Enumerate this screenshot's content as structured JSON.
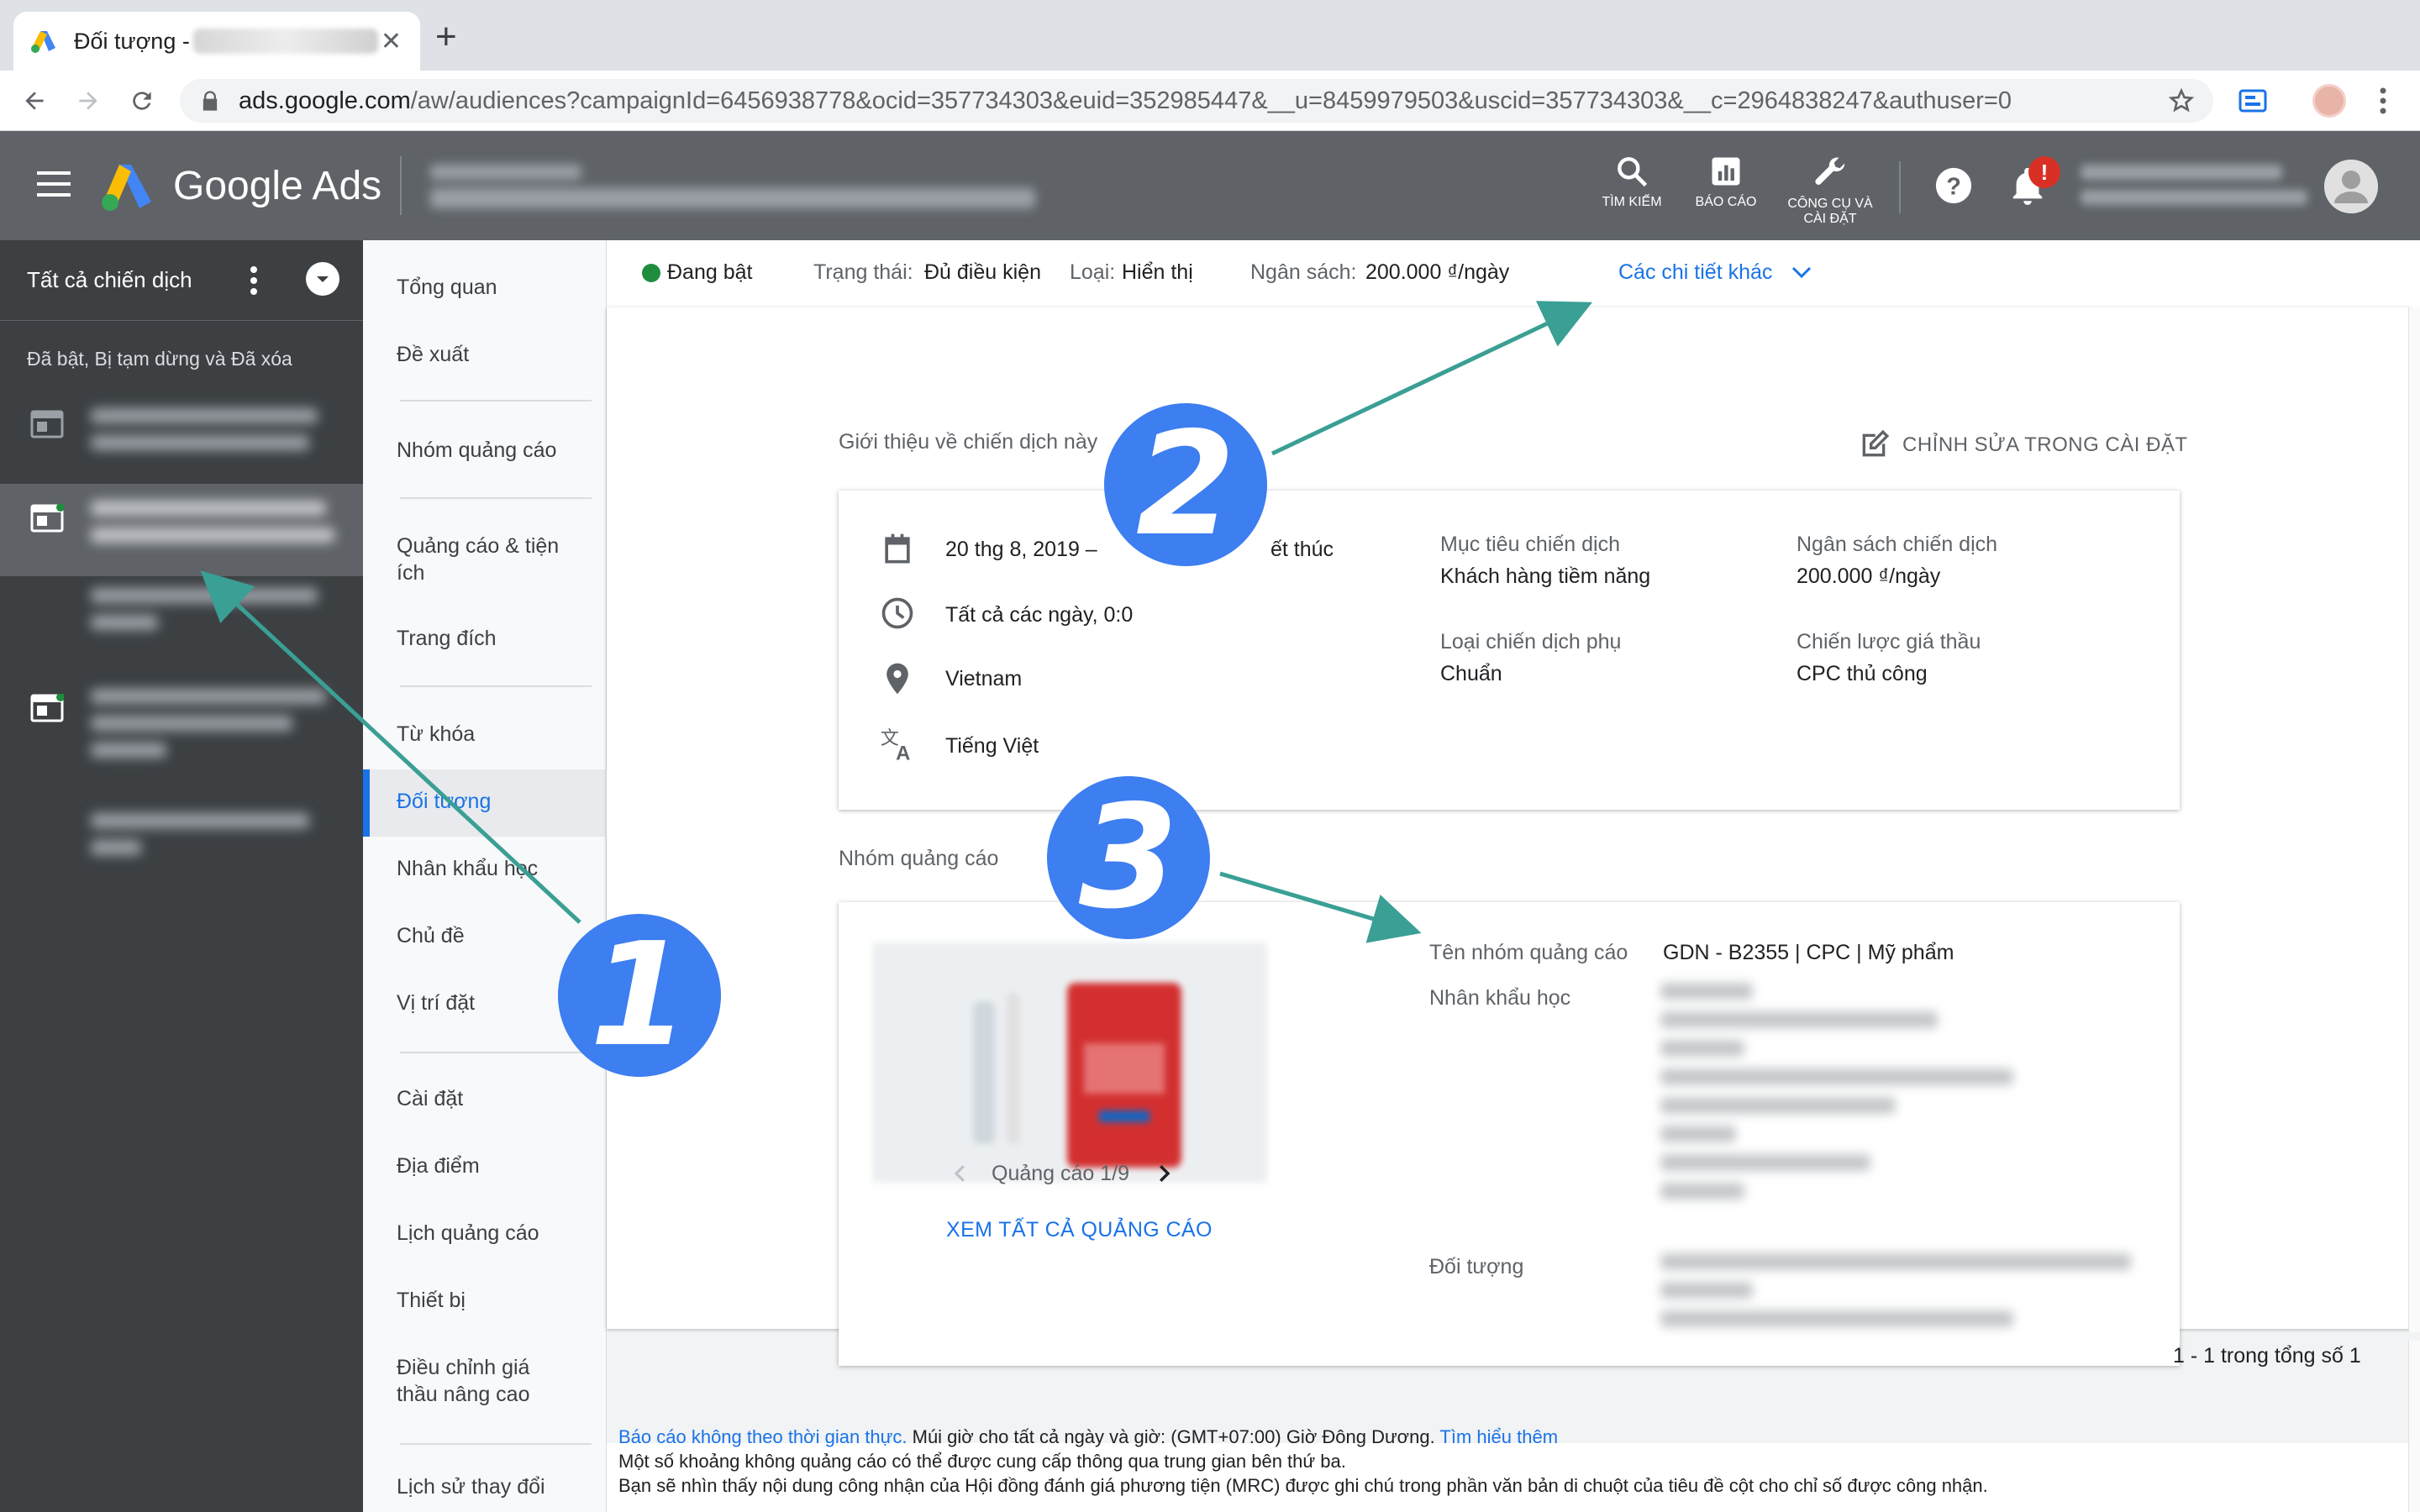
{
  "browser": {
    "tab_title": "Đối tượng -",
    "url_main": "ads.google.com",
    "url_rest": "/aw/audiences?campaignId=6456938778&ocid=357734303&euid=352985447&__u=8459979503&uscid=357734303&__c=2964838247&authuser=0"
  },
  "header": {
    "brand": "Google Ads",
    "tools": [
      {
        "label": "TÌM KIẾM",
        "icon": "search-icon"
      },
      {
        "label": "BÁO CÁO",
        "icon": "reports-icon"
      },
      {
        "label": "CÔNG CỤ VÀ CÀI ĐẶT",
        "icon": "wrench-icon"
      }
    ],
    "notification_badge": "!",
    "colors": {
      "bar": "#5f6368",
      "badge": "#d93025"
    }
  },
  "sidebar": {
    "title": "Tất cả chiến dịch",
    "filter": "Đã bật, Bị tạm dừng và Đã xóa"
  },
  "subnav": {
    "items": [
      "Tổng quan",
      "Đề xuất",
      "Nhóm quảng cáo",
      "Quảng cáo & tiện ích",
      "Trang đích",
      "Từ khóa",
      "Đối tượng",
      "Nhân khẩu học",
      "Chủ đề",
      "Vị trí đặt",
      "Cài đặt",
      "Địa điểm",
      "Lịch quảng cáo",
      "Thiết bị",
      "Điều chỉnh giá thầu nâng cao",
      "Lịch sử thay đổi"
    ],
    "active": "Đối tượng"
  },
  "statusbar": {
    "state": "Đang bật",
    "status_label": "Trạng thái:",
    "status_value": "Đủ điều kiện",
    "type_label": "Loại:",
    "type_value": "Hiển thị",
    "budget_label": "Ngân sách:",
    "budget_value": "200.000 ₫/ngày",
    "more": "Các chi tiết khác"
  },
  "about": {
    "title": "Giới thiệu về chiến dịch này",
    "edit": "CHỈNH SỬA TRONG CÀI ĐẶT",
    "date": "20 thg 8, 2019 –",
    "date_end": "ết thúc",
    "schedule": "Tất cả các ngày, 0:0",
    "location": "Vietnam",
    "language": "Tiếng Việt",
    "goal_label": "Mục tiêu chiến dịch",
    "goal_value": "Khách hàng tiềm năng",
    "budget_label": "Ngân sách chiến dịch",
    "budget_value": "200.000 ₫/ngày",
    "subtype_label": "Loại chiến dịch phụ",
    "subtype_value": "Chuẩn",
    "bidding_label": "Chiến lược giá thầu",
    "bidding_value": "CPC thủ công"
  },
  "adgroup": {
    "title": "Nhóm quảng cáo",
    "pager": "Quảng cáo 1/9",
    "view_all": "XEM TẤT CẢ QUẢNG CÁO",
    "name_label": "Tên nhóm quảng cáo",
    "name_value": "GDN - B2355 | CPC | Mỹ phẩm",
    "demo_label": "Nhân khẩu học",
    "audience_label": "Đối tượng"
  },
  "pagination": "1 - 1 trong tổng số 1",
  "footer": {
    "link1": "Báo cáo không theo thời gian thực.",
    "text1": " Múi giờ cho tất cả ngày và giờ: (GMT+07:00) Giờ Đông Dương.",
    "link2": "Tìm hiểu thêm",
    "line2": "Một số khoảng không quảng cáo có thể được cung cấp thông qua trung gian bên thứ ba.",
    "line3": "Bạn sẽ nhìn thấy nội dung công nhận của Hội đồng đánh giá phương tiện (MRC) được ghi chú trong phần văn bản di chuột của tiêu đề cột cho chỉ số được công nhận."
  },
  "annotations": {
    "one": "1",
    "two": "2",
    "three": "3",
    "color": "#3d7ef0",
    "arrow_color": "#3a9f94"
  }
}
